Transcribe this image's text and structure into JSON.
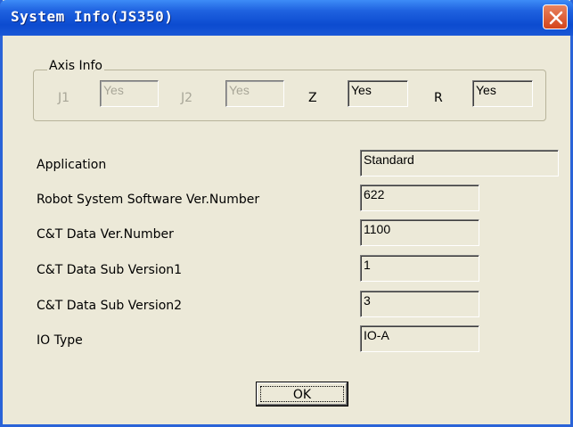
{
  "window": {
    "title": "System Info(JS350)"
  },
  "axis_info": {
    "legend": "Axis Info",
    "axes": [
      {
        "label": "J1",
        "value": "Yes",
        "enabled": false
      },
      {
        "label": "J2",
        "value": "Yes",
        "enabled": false
      },
      {
        "label": "Z",
        "value": "Yes",
        "enabled": true
      },
      {
        "label": "R",
        "value": "Yes",
        "enabled": true
      }
    ]
  },
  "fields": [
    {
      "label": "Application",
      "value": "Standard"
    },
    {
      "label": "Robot System Software Ver.Number",
      "value": "622"
    },
    {
      "label": "C&T Data Ver.Number",
      "value": "1100"
    },
    {
      "label": "C&T Data Sub Version1",
      "value": "1"
    },
    {
      "label": "C&T Data Sub Version2",
      "value": "3"
    },
    {
      "label": "IO Type",
      "value": "IO-A"
    }
  ],
  "buttons": {
    "ok": "OK"
  },
  "icons": {
    "close": "close-icon"
  }
}
